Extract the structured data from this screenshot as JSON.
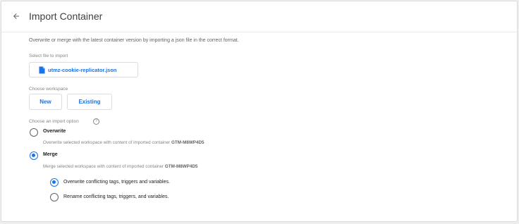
{
  "header": {
    "title": "Import Container",
    "back_icon": "arrow-left-icon"
  },
  "intro": {
    "description": "Overwrite or merge with the latest container version by importing a json file in the correct format."
  },
  "file": {
    "label": "Select file to import",
    "file_name": "utmz-cookie-replicator.json",
    "icon": "file-icon"
  },
  "workspace": {
    "label": "Choose workspace",
    "buttons": [
      {
        "label": "New"
      },
      {
        "label": "Existing"
      }
    ]
  },
  "import_option": {
    "label": "Choose an import option",
    "help_icon": "help-circle-icon",
    "help_glyph": "?",
    "options": [
      {
        "title": "Overwrite",
        "desc": "Overwrite selected workspace with content of imported container",
        "container_id": "GTM-M8WP4D5",
        "checked": false
      },
      {
        "title": "Merge",
        "desc": "Merge selected workspace with content of imported container",
        "container_id": "GTM-M8WP4D5",
        "checked": true
      }
    ],
    "merge_options": [
      {
        "label": "Overwrite conflicting tags, triggers and variables.",
        "checked": true
      },
      {
        "label": "Rename conflicting tags, triggers, and variables.",
        "checked": false
      }
    ]
  },
  "colors": {
    "accent": "#1a73e8",
    "text_primary": "#202124",
    "text_secondary": "#80868b",
    "border": "#dadce0"
  }
}
